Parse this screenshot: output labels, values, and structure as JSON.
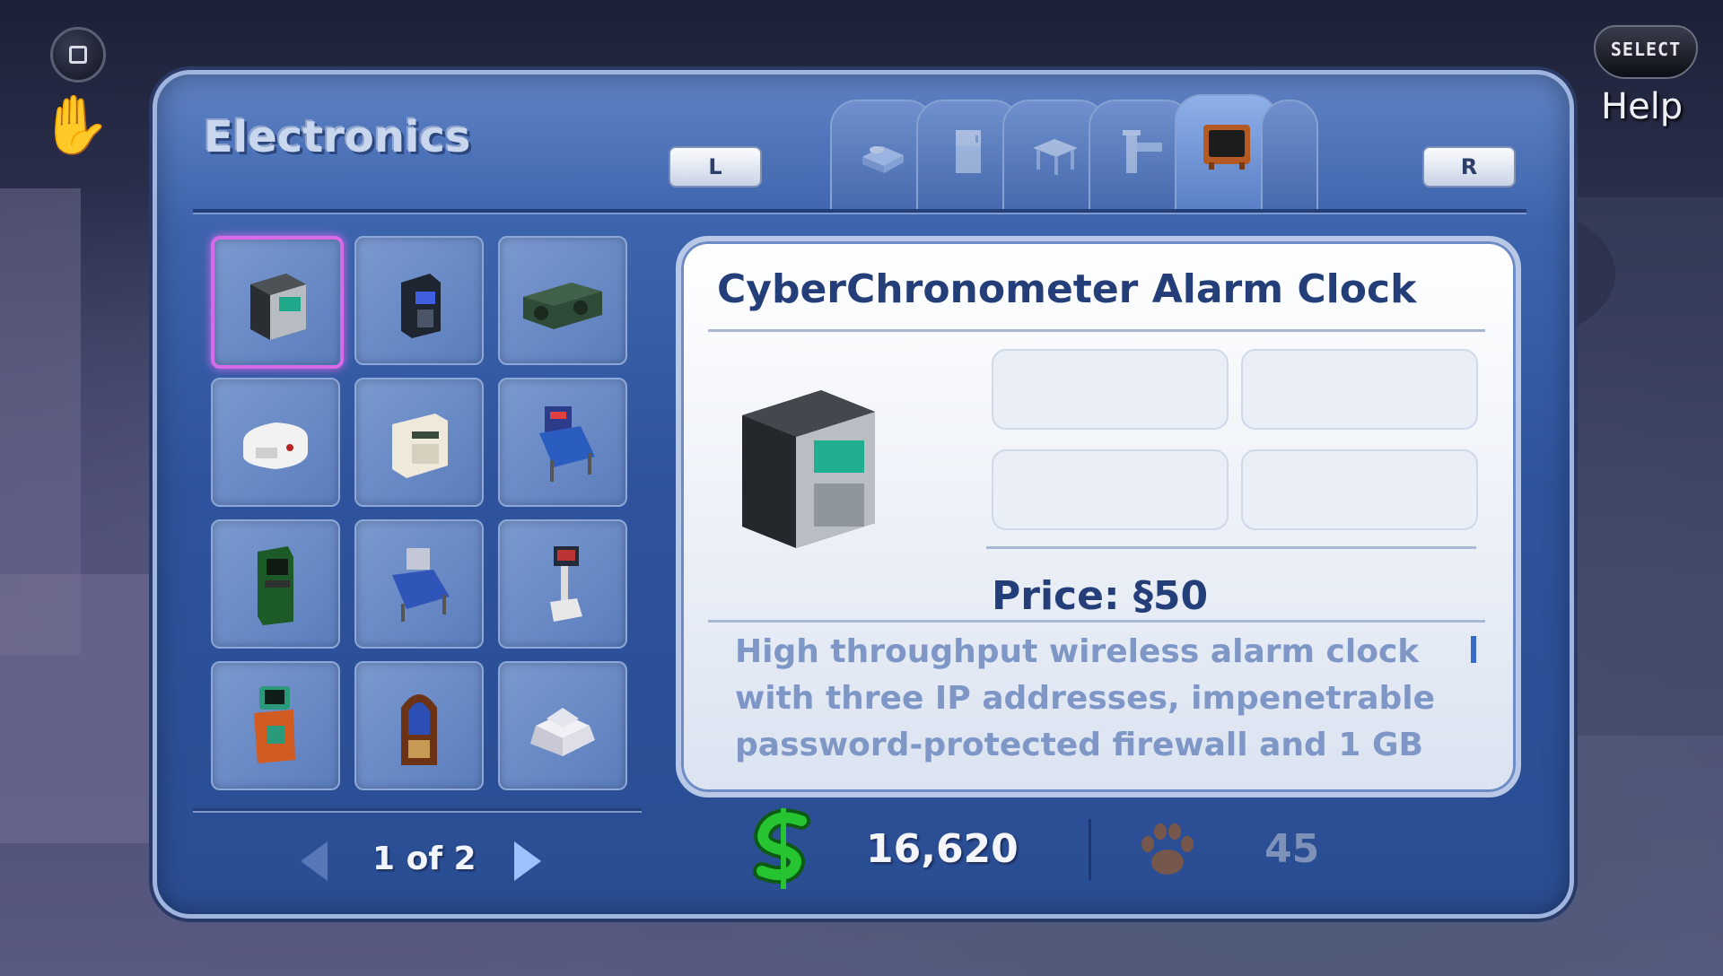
{
  "hud": {
    "select_label": "SELECT",
    "help_label": "Help"
  },
  "catalog": {
    "category_title": "Electronics",
    "tab_left_label": "L",
    "tab_right_label": "R",
    "tabs": [
      {
        "icon": "bed-icon",
        "active": false
      },
      {
        "icon": "fridge-icon",
        "active": false
      },
      {
        "icon": "table-icon",
        "active": false
      },
      {
        "icon": "pipe-icon",
        "active": false
      },
      {
        "icon": "tv-icon",
        "active": true
      }
    ],
    "items": [
      {
        "icon": "alarm-clock-icon",
        "selected": true
      },
      {
        "icon": "phone-icon",
        "selected": false
      },
      {
        "icon": "stereo-icon",
        "selected": false
      },
      {
        "icon": "smoke-detector-icon",
        "selected": false
      },
      {
        "icon": "burglar-alarm-icon",
        "selected": false
      },
      {
        "icon": "pinball-icon",
        "selected": false
      },
      {
        "icon": "arcade-cabinet-icon",
        "selected": false
      },
      {
        "icon": "pinball-icon",
        "selected": false
      },
      {
        "icon": "dance-machine-icon",
        "selected": false
      },
      {
        "icon": "arcade-kiddie-icon",
        "selected": false
      },
      {
        "icon": "jukebox-icon",
        "selected": false
      },
      {
        "icon": "lamp-base-icon",
        "selected": false
      }
    ],
    "pagination": {
      "label": "1 of 2",
      "current": 1,
      "total": 2
    }
  },
  "detail": {
    "name": "CyberChronometer Alarm Clock",
    "price": "Price: §50",
    "description": "High throughput wireless alarm clock with three IP addresses, impenetrable password-protected firewall and 1 GB"
  },
  "footer": {
    "funds": "16,620",
    "pet_points": "45"
  },
  "colors": {
    "panel": "#3d64ad",
    "selected_border": "#d66ae8",
    "title": "#233e78",
    "simoleon_green": "#22c02e"
  }
}
